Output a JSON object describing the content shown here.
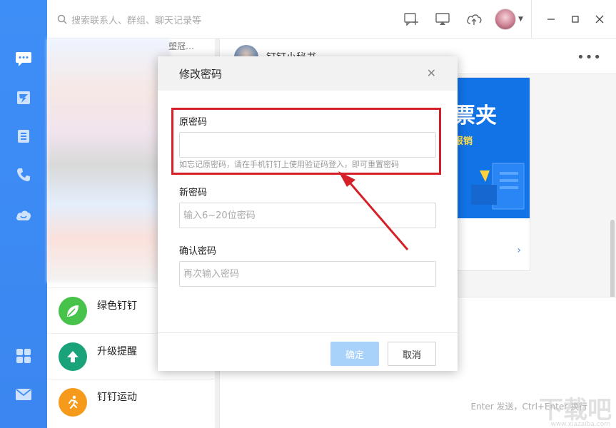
{
  "search": {
    "placeholder": "搜索联系人、群组、聊天记录等"
  },
  "sidebar": {
    "items": [
      {
        "icon": "chat-icon"
      },
      {
        "icon": "ding-icon"
      },
      {
        "icon": "contacts-icon"
      },
      {
        "icon": "phone-icon"
      },
      {
        "icon": "cloud-icon"
      },
      {
        "icon": "apps-grid-icon"
      },
      {
        "icon": "mail-icon"
      }
    ]
  },
  "topbar": {
    "icons": [
      "new-chat-icon",
      "screen-share-icon",
      "cloud-upload-icon",
      "avatar",
      "minimize-icon",
      "maximize-icon",
      "close-icon"
    ]
  },
  "conversations": {
    "blurred_title": "塑冠…",
    "items": [
      {
        "name": "绿色钉钉",
        "icon": "leaf-icon",
        "color": "#47c24b"
      },
      {
        "name": "升级提醒",
        "icon": "upload-arrow-icon",
        "color": "#1aa37a"
      },
      {
        "name": "钉钉运动",
        "icon": "running-icon",
        "color": "#f59a1b"
      }
    ]
  },
  "chat": {
    "title": "钉钉小秘书",
    "banner_title": "票夹",
    "banner_sub": "报销",
    "send_hint": "Enter 发送，Ctrl+Enter 换行"
  },
  "watermark": {
    "text": "下载吧",
    "url": "www.xiazaiba.com"
  },
  "modal": {
    "title": "修改密码",
    "old_label": "原密码",
    "old_value": "",
    "old_hint": "如忘记原密码，请在手机钉钉上使用验证码登入，即可重置密码",
    "new_label": "新密码",
    "new_placeholder": "输入6~20位密码",
    "confirm_label": "确认密码",
    "confirm_placeholder": "再次输入密码",
    "ok_label": "确定",
    "cancel_label": "取消"
  },
  "colors": {
    "accent": "#3e8ef7",
    "highlight": "#d42026",
    "ok_disabled": "#a9d2fa"
  }
}
